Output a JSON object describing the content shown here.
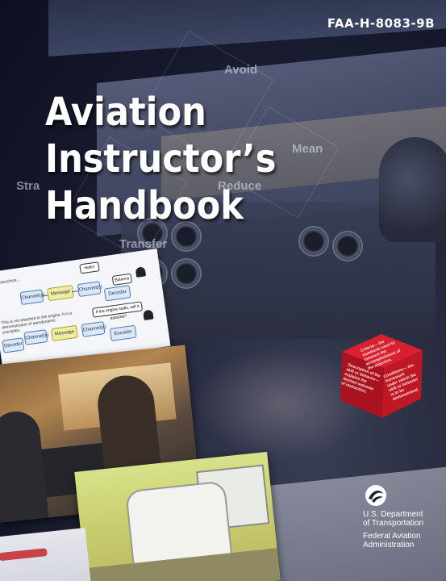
{
  "publication_number": "FAA-H-8083-9B",
  "title": {
    "line1": "Aviation Instructor’s",
    "line2": "Handbook"
  },
  "overlay_words": [
    "Avoid",
    "Mean",
    "Reduce",
    "Transfer",
    "Stra"
  ],
  "diagram": {
    "top_caption": "If parachute...",
    "bubble_top": "Hello!",
    "bubble_right": "Balance",
    "row1": [
      "Channel(s)",
      "Message",
      "Channel(s)",
      "Decoder"
    ],
    "mid_caption": "This is not attached to the engine. It is a demonstration of aerodynamic principles.",
    "bubble_mid": "If the engine stalls, will it assume?",
    "row2": [
      "Decoder",
      "Channel(s)",
      "Message",
      "Channel(s)",
      "Encoder"
    ]
  },
  "cube": {
    "face_top": "Criteria— the standards used to measure the accomplishment of the objective.",
    "face_left": "Description of the skill or behavior— explains the desired outcome of instruction.",
    "face_right": "Conditions— the framework under which the skill or behavior is to be demonstrated."
  },
  "agency": {
    "dept_line1": "U.S. Department",
    "dept_line2": "of Transportation",
    "admin_line1": "Federal Aviation",
    "admin_line2": "Administration"
  },
  "colors": {
    "background": "#1c2033",
    "title_text": "#ffffff",
    "cube_red": "#c8192a",
    "diagram_blue": "#dce8f6",
    "diagram_yellow": "#f3ec9c"
  }
}
